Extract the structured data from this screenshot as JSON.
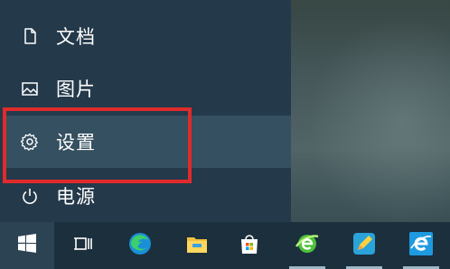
{
  "start_menu": {
    "items": [
      {
        "label": "文档",
        "icon": "document-icon"
      },
      {
        "label": "图片",
        "icon": "pictures-icon"
      },
      {
        "label": "设置",
        "icon": "gear-icon"
      },
      {
        "label": "电源",
        "icon": "power-icon"
      }
    ],
    "highlighted_item": "设置"
  },
  "taskbar": {
    "buttons": [
      {
        "icon": "windows-start-icon"
      },
      {
        "icon": "task-view-icon"
      },
      {
        "icon": "edge-icon"
      },
      {
        "icon": "file-explorer-icon"
      },
      {
        "icon": "microsoft-store-icon"
      },
      {
        "icon": "green-ie-browser-icon",
        "running": true
      },
      {
        "icon": "notes-pencil-icon",
        "running": true
      },
      {
        "icon": "internet-explorer-icon",
        "running": true
      }
    ]
  },
  "colors": {
    "menu_bg": "#24394a",
    "highlight_border": "#e02b2b",
    "taskbar_bg": "#1c2f3d"
  }
}
